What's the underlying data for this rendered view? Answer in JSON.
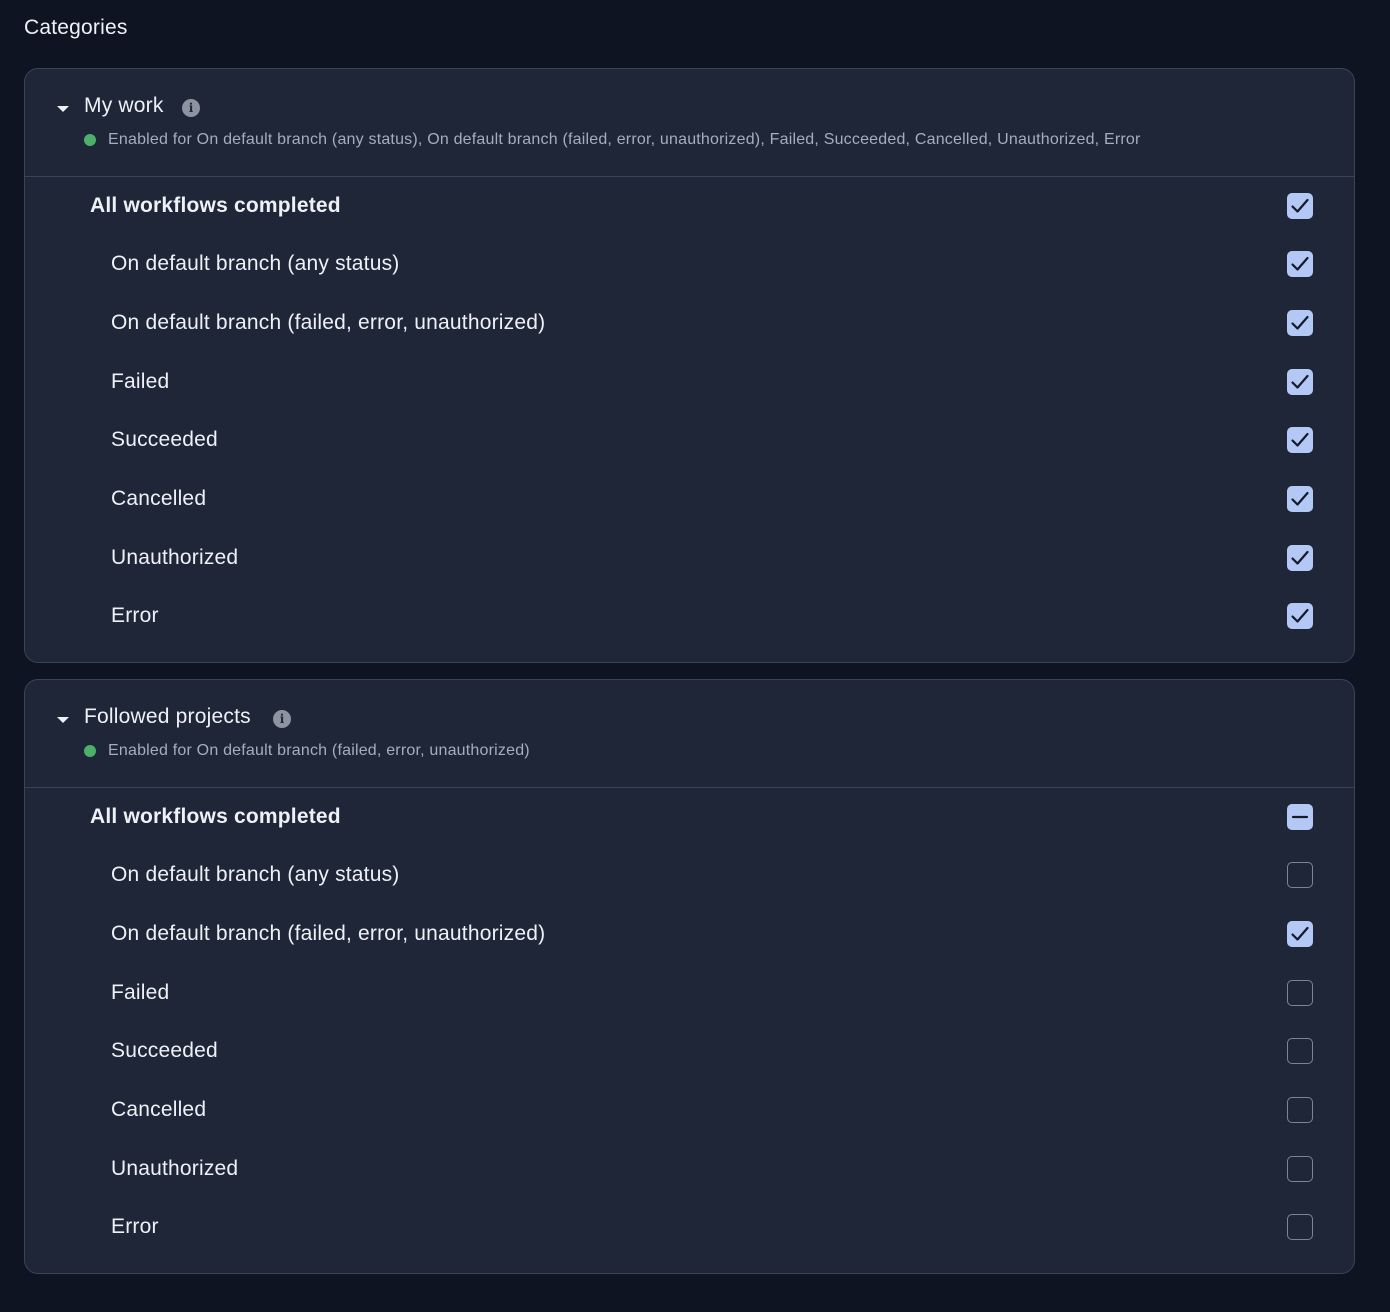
{
  "page": {
    "title": "Categories"
  },
  "sections": [
    {
      "title": "My work",
      "status": "Enabled for On default branch (any status), On default branch (failed, error, unauthorized), Failed, Succeeded, Cancelled, Unauthorized, Error",
      "group": {
        "label": "All workflows completed",
        "state": "checked"
      },
      "items": [
        {
          "label": "On default branch (any status)",
          "state": "checked"
        },
        {
          "label": "On default branch (failed, error, unauthorized)",
          "state": "checked"
        },
        {
          "label": "Failed",
          "state": "checked"
        },
        {
          "label": "Succeeded",
          "state": "checked"
        },
        {
          "label": "Cancelled",
          "state": "checked"
        },
        {
          "label": "Unauthorized",
          "state": "checked"
        },
        {
          "label": "Error",
          "state": "checked"
        }
      ]
    },
    {
      "title": "Followed projects",
      "status": "Enabled for On default branch (failed, error, unauthorized)",
      "group": {
        "label": "All workflows completed",
        "state": "mixed"
      },
      "items": [
        {
          "label": "On default branch (any status)",
          "state": "unchecked"
        },
        {
          "label": "On default branch (failed, error, unauthorized)",
          "state": "checked"
        },
        {
          "label": "Failed",
          "state": "unchecked"
        },
        {
          "label": "Succeeded",
          "state": "unchecked"
        },
        {
          "label": "Cancelled",
          "state": "unchecked"
        },
        {
          "label": "Unauthorized",
          "state": "unchecked"
        },
        {
          "label": "Error",
          "state": "unchecked"
        }
      ]
    }
  ],
  "icons": {
    "caret": "caret-down-icon",
    "info": "info-icon",
    "status": "status-dot-icon",
    "check": "check-icon",
    "mixed": "minus-icon"
  },
  "colors": {
    "background": "#0e1422",
    "panel": "#1e2638",
    "accent": "#b4c8f6",
    "status_enabled": "#4caf6a"
  }
}
